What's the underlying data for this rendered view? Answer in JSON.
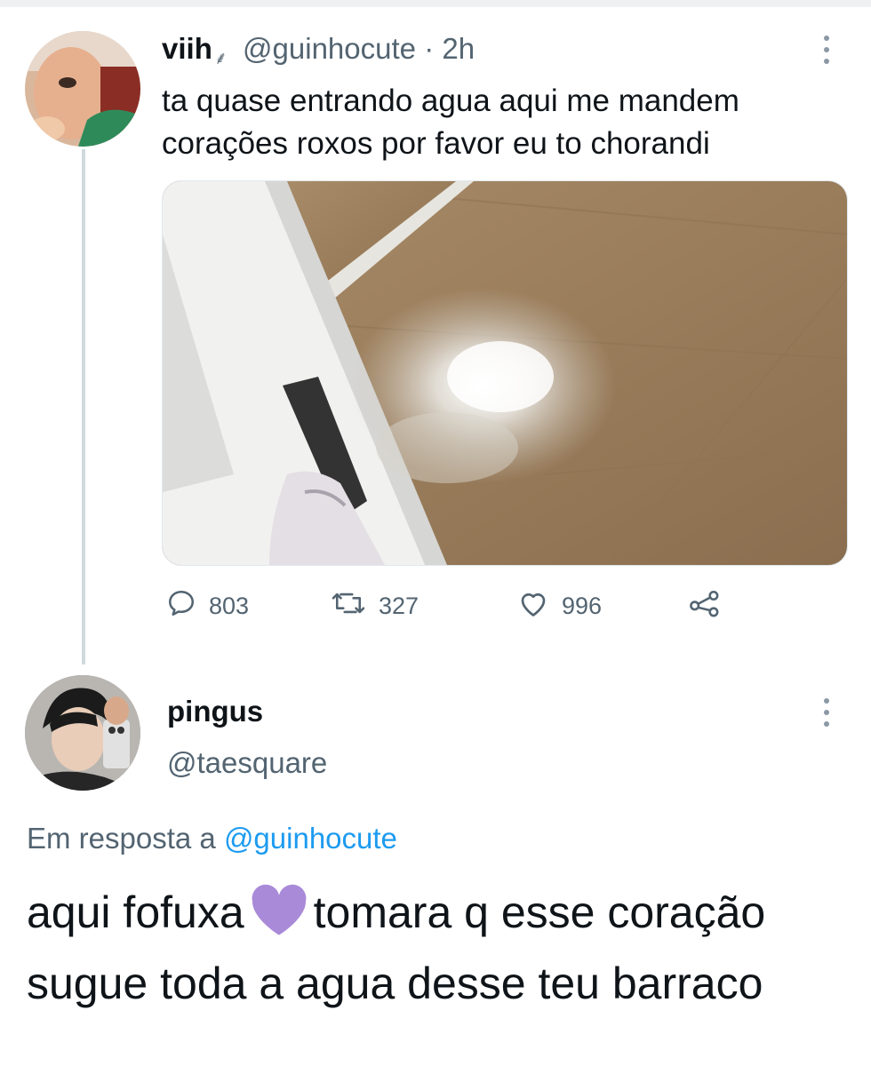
{
  "tweet": {
    "display_name": "viih",
    "name_emoji": "⸙",
    "handle": "@guinhocute",
    "separator": "·",
    "time": "2h",
    "text": "ta quase entrando agua aqui me mandem corações roxos por favor eu to chorandi",
    "stats": {
      "replies": "803",
      "retweets": "327",
      "likes": "996"
    }
  },
  "reply": {
    "display_name": "pingus",
    "handle": "@taesquare",
    "replying_prefix": "Em resposta a",
    "replying_to": "@guinhocute",
    "text_before_heart": "aqui fofuxa",
    "heart_emoji": "purple-heart",
    "text_after_heart": "tomara q esse coração sugue toda a agua desse teu barraco"
  },
  "icons": {
    "reply": "reply-icon",
    "retweet": "retweet-icon",
    "like": "heart-icon",
    "share": "share-icon",
    "more": "more-icon"
  },
  "colors": {
    "primary_text": "#0f1419",
    "secondary_text": "#536471",
    "mention": "#1d9bf0",
    "purple_heart": "#a98ad8"
  }
}
